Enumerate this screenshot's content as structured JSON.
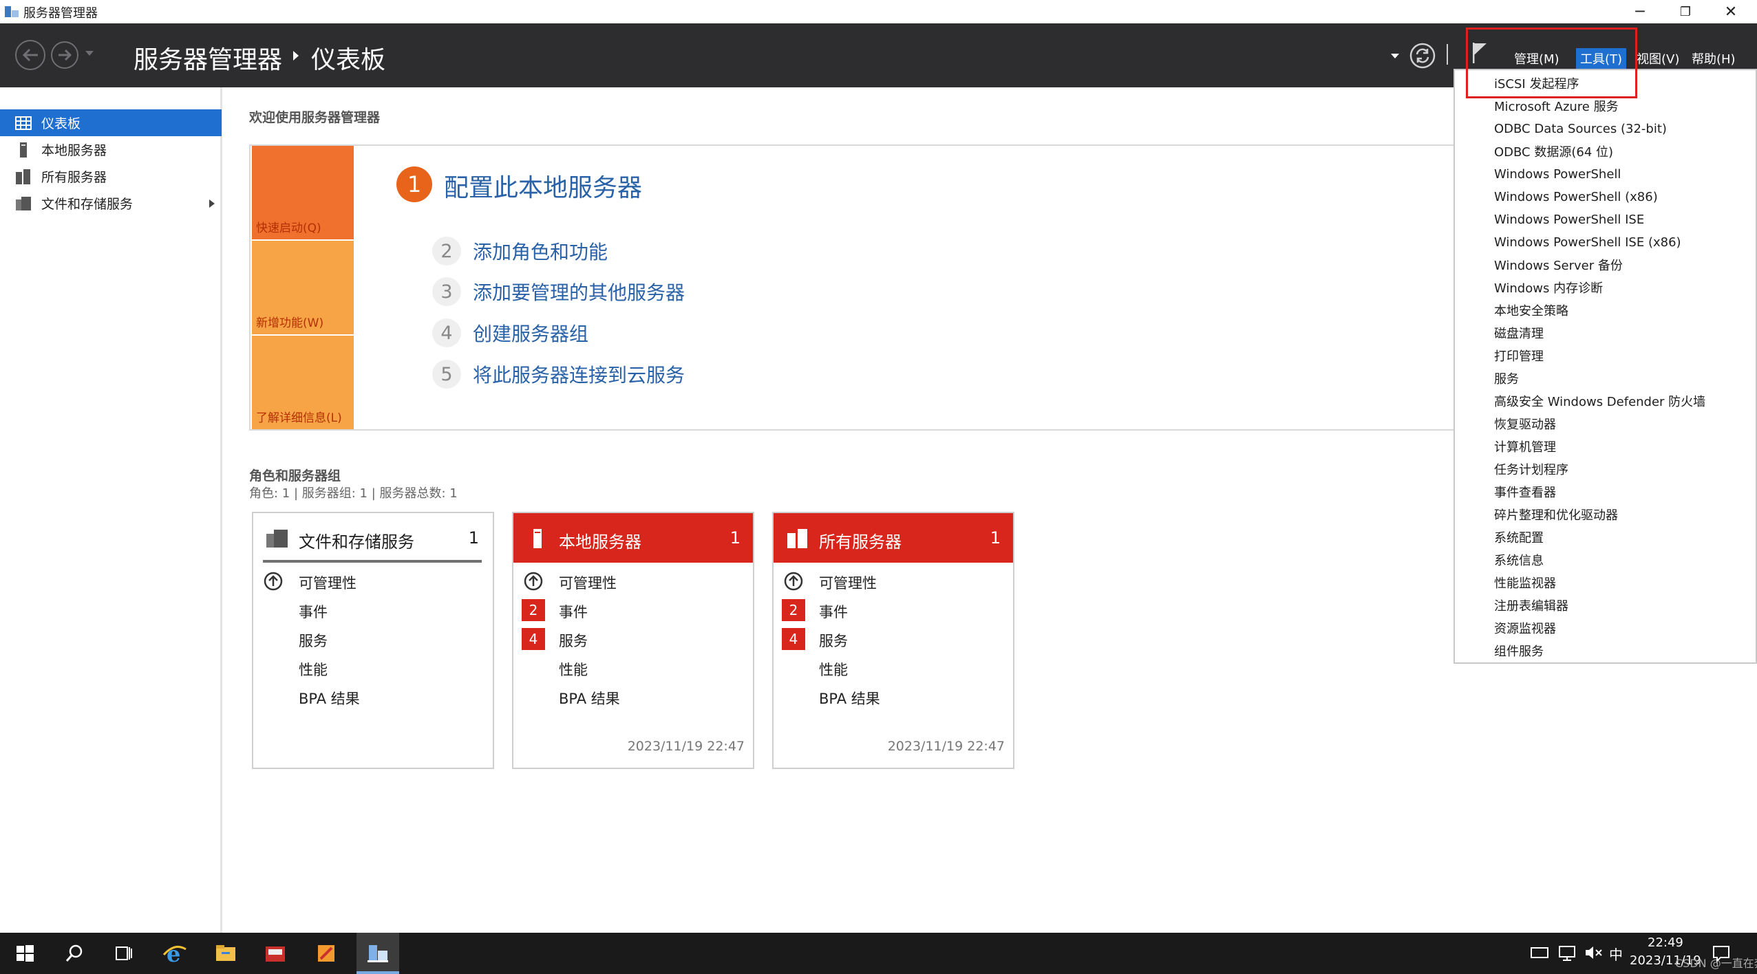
{
  "window": {
    "title": "服务器管理器",
    "minimize": "─",
    "restore": "❐",
    "close": "✕"
  },
  "header": {
    "breadcrumb_root": "服务器管理器",
    "breadcrumb_current": "仪表板",
    "menus": [
      {
        "label": "管理(M)"
      },
      {
        "label": "工具(T)"
      },
      {
        "label": "视图(V)"
      },
      {
        "label": "帮助(H)"
      }
    ]
  },
  "sidebar": {
    "items": [
      {
        "label": "仪表板"
      },
      {
        "label": "本地服务器"
      },
      {
        "label": "所有服务器"
      },
      {
        "label": "文件和存储服务"
      }
    ]
  },
  "welcome": {
    "title": "欢迎使用服务器管理器",
    "tiles": [
      {
        "label": "快速启动(Q)",
        "color": "#f0702e"
      },
      {
        "label": "新增功能(W)",
        "color": "#f6a445"
      },
      {
        "label": "了解详细信息(L)",
        "color": "#f6a445"
      }
    ],
    "main_step": {
      "number": "1",
      "text": "配置此本地服务器"
    },
    "steps": [
      {
        "number": "2",
        "text": "添加角色和功能"
      },
      {
        "number": "3",
        "text": "添加要管理的其他服务器"
      },
      {
        "number": "4",
        "text": "创建服务器组"
      },
      {
        "number": "5",
        "text": "将此服务器连接到云服务"
      }
    ]
  },
  "roles": {
    "title": "角色和服务器组",
    "subtitle": "角色: 1 | 服务器组: 1 | 服务器总数: 1",
    "cards": [
      {
        "title": "文件和存储服务",
        "count": "1",
        "rows": [
          {
            "label": "可管理性",
            "badge": ""
          },
          {
            "label": "事件",
            "badge": ""
          },
          {
            "label": "服务",
            "badge": ""
          },
          {
            "label": "性能",
            "badge": ""
          },
          {
            "label": "BPA 结果",
            "badge": ""
          }
        ],
        "timestamp": ""
      },
      {
        "title": "本地服务器",
        "count": "1",
        "rows": [
          {
            "label": "可管理性",
            "badge": ""
          },
          {
            "label": "事件",
            "badge": "2"
          },
          {
            "label": "服务",
            "badge": "4"
          },
          {
            "label": "性能",
            "badge": ""
          },
          {
            "label": "BPA 结果",
            "badge": ""
          }
        ],
        "timestamp": "2023/11/19 22:47"
      },
      {
        "title": "所有服务器",
        "count": "1",
        "rows": [
          {
            "label": "可管理性",
            "badge": ""
          },
          {
            "label": "事件",
            "badge": "2"
          },
          {
            "label": "服务",
            "badge": "4"
          },
          {
            "label": "性能",
            "badge": ""
          },
          {
            "label": "BPA 结果",
            "badge": ""
          }
        ],
        "timestamp": "2023/11/19 22:47"
      }
    ]
  },
  "tools_menu": {
    "items": [
      "iSCSI 发起程序",
      "Microsoft Azure 服务",
      "ODBC Data Sources (32-bit)",
      "ODBC 数据源(64 位)",
      "Windows PowerShell",
      "Windows PowerShell (x86)",
      "Windows PowerShell ISE",
      "Windows PowerShell ISE (x86)",
      "Windows Server 备份",
      "Windows 内存诊断",
      "本地安全策略",
      "磁盘清理",
      "打印管理",
      "服务",
      "高级安全 Windows Defender 防火墙",
      "恢复驱动器",
      "计算机管理",
      "任务计划程序",
      "事件查看器",
      "碎片整理和优化驱动器",
      "系统配置",
      "系统信息",
      "性能监视器",
      "注册表编辑器",
      "资源监视器",
      "组件服务"
    ]
  },
  "taskbar": {
    "time": "22:49",
    "date": "2023/11/19",
    "ime": "中",
    "watermark": "CSDN @一直在奔跑的我"
  },
  "colors": {
    "accent": "#1f6fd0",
    "header_bg": "#2d2d30",
    "card_red": "#d9261c",
    "step_orange": "#e8641b",
    "highlight_box": "#e02020"
  }
}
